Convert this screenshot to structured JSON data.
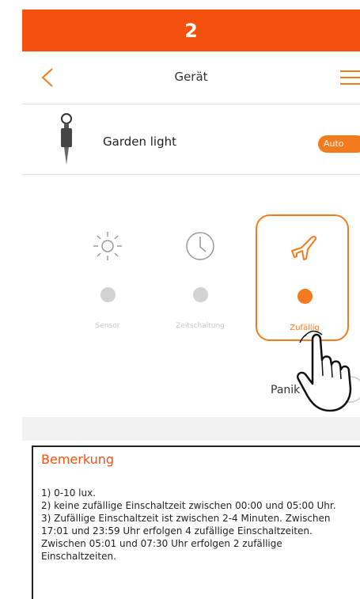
{
  "banner": {
    "number": "2"
  },
  "header": {
    "title": "Gerät"
  },
  "device": {
    "name": "Garden light",
    "badge": "Auto"
  },
  "modes": [
    {
      "label": "Sensor",
      "icon": "sun-icon",
      "active": false
    },
    {
      "label": "Zeitschaltung",
      "icon": "clock-icon",
      "active": false
    },
    {
      "label": "Zufällig",
      "icon": "airplane-icon",
      "active": true
    }
  ],
  "panik": {
    "label": "Panik",
    "on": false
  },
  "remark": {
    "title": "Bemerkung",
    "lines": [
      "1) 0-10 lux.",
      "2) keine zufällige Einschaltzeit zwischen 00:00 und 05:00 Uhr.",
      "3) Zufällige Einschaltzeit ist zwischen 2-4 Minuten. Zwischen 17:01 und 23:59 Uhr erfolgen 4 zufällige Einschaltzeiten. Zwischen 05:01 und 07:30 Uhr erfolgen 2 zufällige Einschaltzeiten."
    ]
  },
  "colors": {
    "accent": "#f47a1e",
    "banner": "#f4500e"
  }
}
